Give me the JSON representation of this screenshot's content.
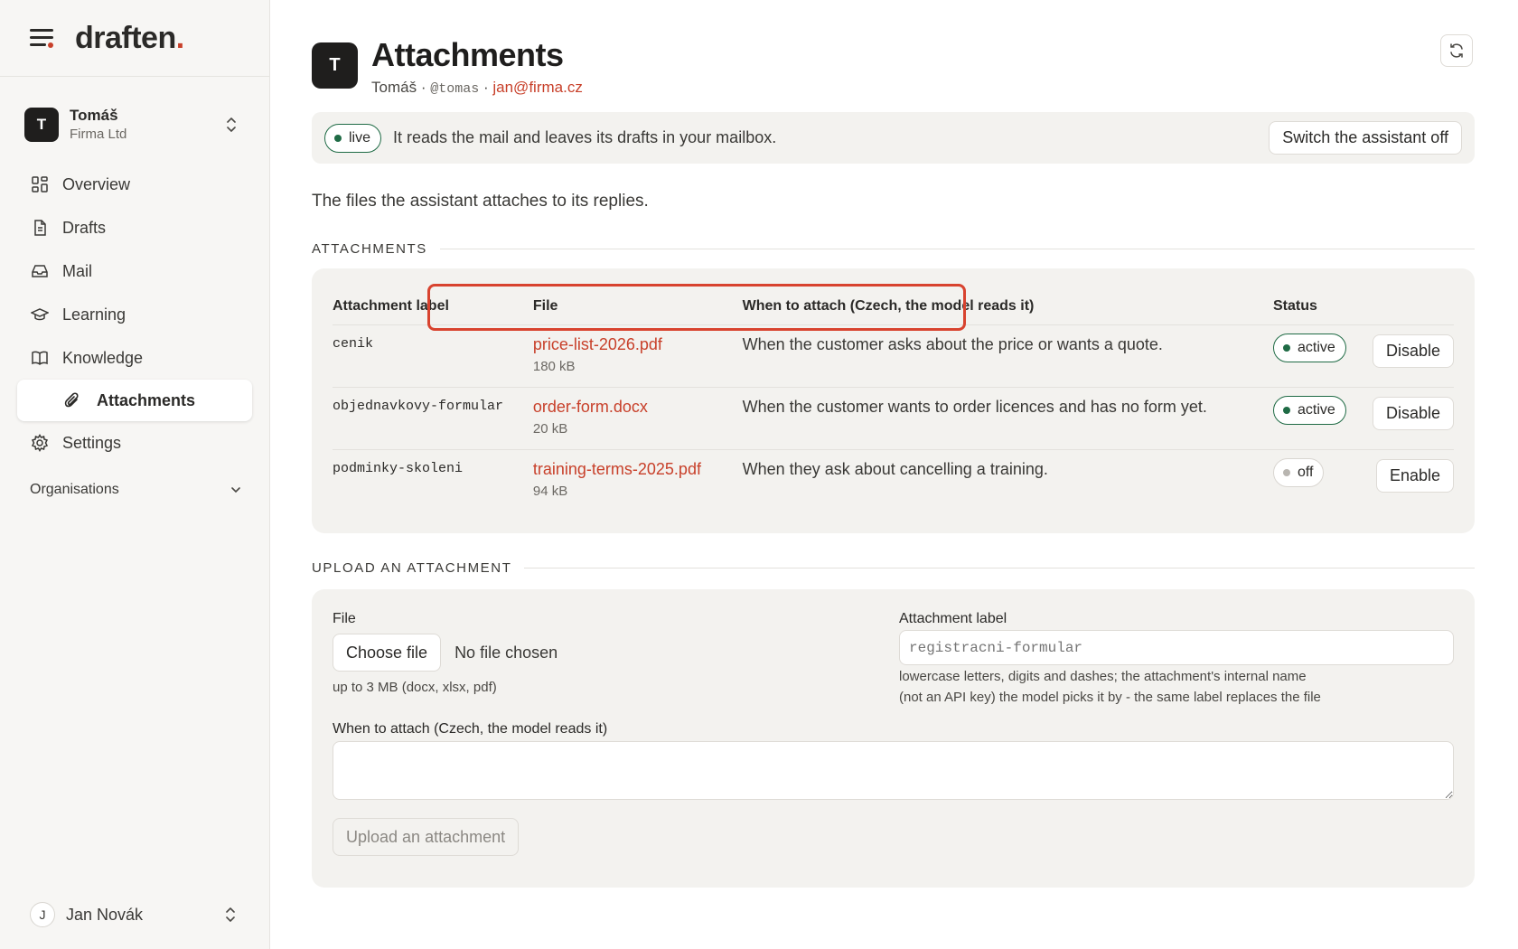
{
  "brand": {
    "name": "draften",
    "dot": "."
  },
  "account": {
    "initial": "T",
    "name": "Tomáš",
    "org": "Firma Ltd"
  },
  "nav": [
    {
      "label": "Overview",
      "icon": "grid-icon"
    },
    {
      "label": "Drafts",
      "icon": "document-icon"
    },
    {
      "label": "Mail",
      "icon": "inbox-icon"
    },
    {
      "label": "Learning",
      "icon": "graduation-cap-icon"
    },
    {
      "label": "Knowledge",
      "icon": "book-icon"
    },
    {
      "label": "Attachments",
      "icon": "paperclip-icon",
      "active": true
    },
    {
      "label": "Settings",
      "icon": "gear-icon"
    }
  ],
  "organisations_label": "Organisations",
  "footer_user": {
    "initial": "J",
    "name": "Jan Novák"
  },
  "header": {
    "initial": "T",
    "title": "Attachments",
    "name": "Tomáš",
    "sep1": "·",
    "handle": "@tomas",
    "sep2": "·",
    "email": "jan@firma.cz"
  },
  "banner": {
    "status": "live",
    "text": "It reads the mail and leaves its drafts in your mailbox.",
    "button": "Switch the assistant off"
  },
  "intro": "The files the assistant attaches to its replies.",
  "attachments_section": {
    "title": "ATTACHMENTS",
    "columns": [
      "Attachment label",
      "File",
      "When to attach (Czech, the model reads it)",
      "Status",
      ""
    ],
    "rows": [
      {
        "label": "cenik",
        "file": "price-list-2026.pdf",
        "size": "180 kB",
        "when": "When the customer asks about the price or wants a quote.",
        "status": "active",
        "action": "Disable"
      },
      {
        "label": "objednavkovy-formular",
        "file": "order-form.docx",
        "size": "20 kB",
        "when": "When the customer wants to order licences and has no form yet.",
        "status": "active",
        "action": "Disable"
      },
      {
        "label": "podminky-skoleni",
        "file": "training-terms-2025.pdf",
        "size": "94 kB",
        "when": "When they ask about cancelling a training.",
        "status": "off",
        "action": "Enable"
      }
    ]
  },
  "upload_section": {
    "title": "UPLOAD AN ATTACHMENT",
    "file_label": "File",
    "choose_button": "Choose file",
    "no_file": "No file chosen",
    "file_hint": "up to 3 MB (docx, xlsx, pdf)",
    "label_label": "Attachment label",
    "label_placeholder": "registracni-formular",
    "label_hint_1": "lowercase letters, digits and dashes; the attachment's internal name",
    "label_hint_2": "(not an API key) the model picks it by - the same label replaces the file",
    "when_label": "When to attach (Czech, the model reads it)",
    "when_value": "",
    "submit": "Upload an attachment"
  },
  "colors": {
    "accent": "#c8402a",
    "active_green": "#1f6b45",
    "highlight": "#d8432f"
  }
}
